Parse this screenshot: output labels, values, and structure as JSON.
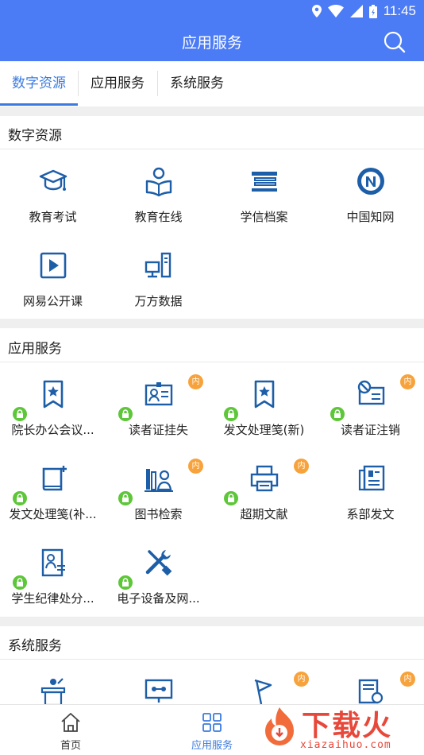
{
  "status": {
    "time": "11:45"
  },
  "header": {
    "title": "应用服务"
  },
  "tabs": [
    {
      "label": "数字资源",
      "active": true
    },
    {
      "label": "应用服务",
      "active": false
    },
    {
      "label": "系统服务",
      "active": false
    }
  ],
  "sections": {
    "digital": {
      "title": "数字资源",
      "items": [
        {
          "label": "教育考试",
          "icon": "graduation-cap-icon"
        },
        {
          "label": "教育在线",
          "icon": "reader-icon"
        },
        {
          "label": "学信档案",
          "icon": "archive-icon"
        },
        {
          "label": "中国知网",
          "icon": "cnki-logo-icon"
        },
        {
          "label": "网易公开课",
          "icon": "video-play-icon"
        },
        {
          "label": "万方数据",
          "icon": "computer-server-icon"
        }
      ]
    },
    "app": {
      "title": "应用服务",
      "items": [
        {
          "label": "院长办公会议...",
          "icon": "bookmark-star-icon",
          "badge": ""
        },
        {
          "label": "读者证挂失",
          "icon": "id-card-icon",
          "badge": "内"
        },
        {
          "label": "发文处理笺(新)",
          "icon": "bookmark-star-icon",
          "badge": ""
        },
        {
          "label": "读者证注销",
          "icon": "card-cancel-icon",
          "badge": "内"
        },
        {
          "label": "发文处理笺(补...",
          "icon": "book-add-icon",
          "badge": ""
        },
        {
          "label": "图书检索",
          "icon": "book-search-icon",
          "badge": "内"
        },
        {
          "label": "超期文献",
          "icon": "printer-icon",
          "badge": "内"
        },
        {
          "label": "系部发文",
          "icon": "document-icon",
          "badge": ""
        },
        {
          "label": "学生纪律处分...",
          "icon": "person-document-icon",
          "badge": ""
        },
        {
          "label": "电子设备及网...",
          "icon": "tools-icon",
          "badge": ""
        }
      ]
    },
    "system": {
      "title": "系统服务",
      "items": [
        {
          "icon": "podium-icon",
          "badge": ""
        },
        {
          "icon": "monitor-network-icon",
          "badge": ""
        },
        {
          "icon": "flag-icon",
          "badge": "内"
        },
        {
          "icon": "document-stack-icon",
          "badge": "内"
        }
      ]
    }
  },
  "bottom_nav": [
    {
      "label": "首页",
      "icon": "home-icon",
      "active": false
    },
    {
      "label": "应用服务",
      "icon": "grid-icon",
      "active": true
    }
  ],
  "watermark": {
    "title": "下载火",
    "subtitle": "xiazaihuo.com"
  },
  "colors": {
    "primary": "#4b7bf5",
    "accent": "#3b7be0",
    "icon": "#1d5ea8",
    "lock": "#5ec639",
    "badge": "#f7a23b"
  }
}
